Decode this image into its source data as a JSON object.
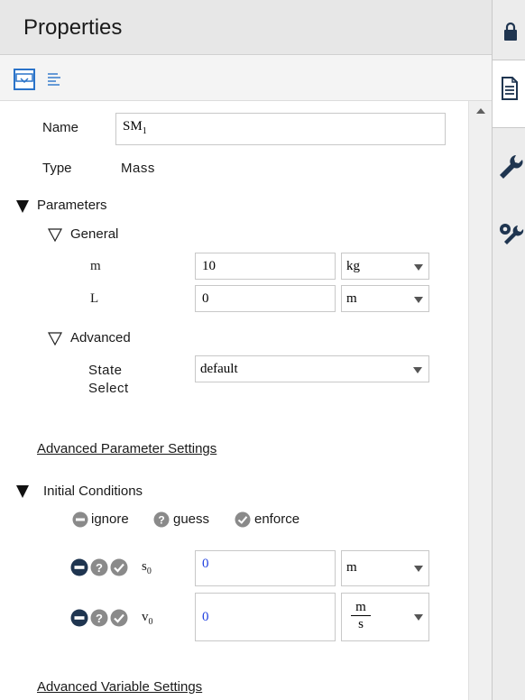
{
  "panel": {
    "title": "Properties"
  },
  "toolbar": {
    "icons": [
      "property-view-icon",
      "list-view-icon"
    ]
  },
  "general_section": {
    "name_label": "Name",
    "name_value_base": "SM",
    "name_value_sub": "1",
    "type_label": "Type",
    "type_value": "Mass"
  },
  "parameters": {
    "header": "Parameters",
    "general": {
      "header": "General",
      "rows": [
        {
          "label": "m",
          "value": "10",
          "unit": "kg"
        },
        {
          "label": "L",
          "value": "0",
          "unit": "m"
        }
      ]
    },
    "advanced": {
      "header": "Advanced",
      "state_select_label_1": "State",
      "state_select_label_2": "Select",
      "state_select_value": "default"
    },
    "advanced_link": "Advanced Parameter Settings"
  },
  "initial_conditions": {
    "header": "Initial Conditions",
    "legend": {
      "ignore": "ignore",
      "guess": "guess",
      "enforce": "enforce"
    },
    "rows": [
      {
        "label_base": "s",
        "label_sub": "0",
        "value": "0",
        "unit": "m"
      },
      {
        "label_base": "v",
        "label_sub": "0",
        "value": "0",
        "unit_num": "m",
        "unit_den": "s"
      }
    ],
    "advanced_link": "Advanced Variable Settings"
  },
  "sidebar": {
    "icons": [
      "lock-icon",
      "document-icon",
      "wrench-icon",
      "settings-wrench-icon"
    ]
  },
  "colors": {
    "accent": "#2a73c9",
    "input_value_blue": "#1f3fe0",
    "status_icon_dark": "#1f3550",
    "status_icon_gray": "#8a8a8a"
  }
}
